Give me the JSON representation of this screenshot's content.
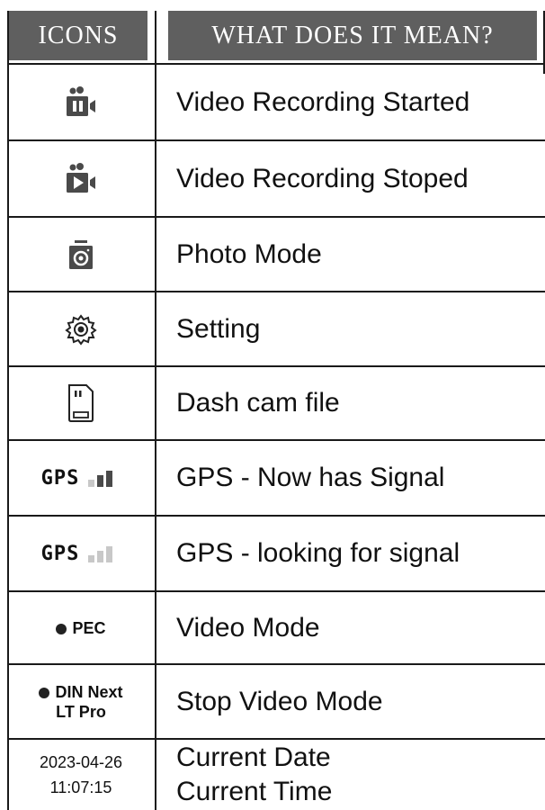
{
  "header": {
    "col_icons": "ICONS",
    "col_meaning": "WHAT DOES IT MEAN?"
  },
  "rows": [
    {
      "icon": "video-recording-started-icon",
      "text": "Video Recording Started"
    },
    {
      "icon": "video-recording-stopped-icon",
      "text": "Video Recording Stoped"
    },
    {
      "icon": "camera-icon",
      "text": "Photo Mode"
    },
    {
      "icon": "gear-icon",
      "text": "Setting"
    },
    {
      "icon": "sd-card-icon",
      "text": "Dash cam file"
    },
    {
      "icon_label": "GPS",
      "text": "GPS - Now has Signal"
    },
    {
      "icon_label": "GPS",
      "text": "GPS - looking for signal"
    },
    {
      "icon_label": "PEC",
      "text": "Video Mode"
    },
    {
      "icon_label_line1": "DIN Next",
      "icon_label_line2": "LT Pro",
      "text": "Stop Video Mode"
    },
    {
      "date": "2023-04-26",
      "time": "11:07:15",
      "text_line1": "Current Date",
      "text_line2": "Current Time"
    }
  ],
  "colors": {
    "header_bg": "#5f5f5f",
    "icon_gray": "#4a4a4a",
    "signal_light": "#c8c8c8"
  }
}
